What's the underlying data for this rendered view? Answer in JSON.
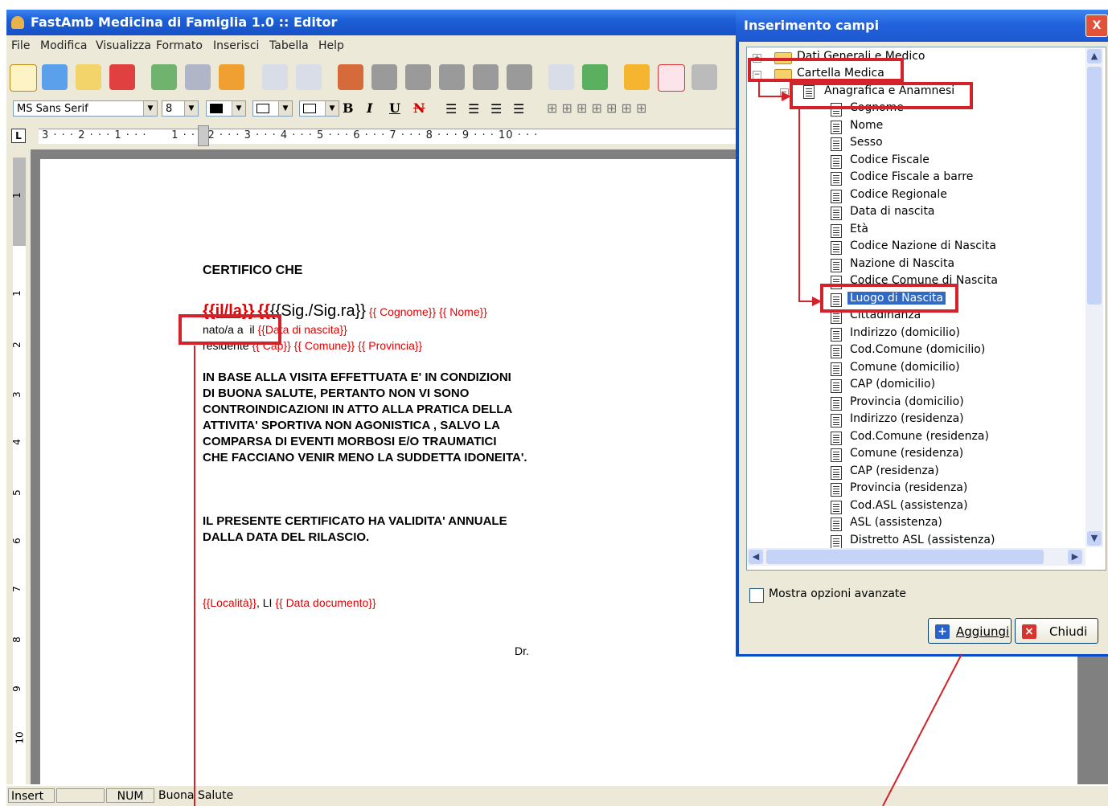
{
  "window": {
    "title": "FastAmb Medicina di Famiglia 1.0 :: Editor"
  },
  "menu": [
    {
      "label": "File"
    },
    {
      "label": "Modifica"
    },
    {
      "label": "Visualizza"
    },
    {
      "label": "Formato"
    },
    {
      "label": "Inserisci"
    },
    {
      "label": "Tabella"
    },
    {
      "label": "Help"
    }
  ],
  "format_bar": {
    "font": "MS Sans Serif",
    "size": "8",
    "bold": "B",
    "italic": "I",
    "underline": "U",
    "strike": "N"
  },
  "ruler": {
    "label": "L",
    "marks": "3 · · · 2 · · · 1 · · ·      1 · · · 2 · · · 3 · · · 4 · · · 5 · · · 6 · · · 7 · · · 8 · · · 9 · · · 10 · · ·"
  },
  "vruler": [
    "1",
    "1",
    "2",
    "3",
    "4",
    "5",
    "6",
    "7",
    "8",
    "9",
    "10"
  ],
  "document": {
    "heading": "CERTIFICO CHE",
    "line1": {
      "a": "{{il/la}}",
      "b": "{{Sig./Sig.ra}}",
      "c": "{{ Cognome}}",
      "d": "{{ Nome}}"
    },
    "line2": {
      "a": "nato/a a  il ",
      "b": "{{Data di nascita}}"
    },
    "line3": {
      "a": "residente ",
      "b": "{{ Cap}}",
      "c": "{{ Comune}}",
      "d": "{{ Provincia}}"
    },
    "body": [
      "IN BASE ALLA VISITA EFFETTUATA E'  IN CONDIZIONI",
      "DI BUONA SALUTE, PERTANTO NON VI SONO",
      "CONTROINDICAZIONI IN ATTO ALLA PRATICA DELLA",
      "ATTIVITA' SPORTIVA NON AGONISTICA , SALVO LA",
      "COMPARSA DI EVENTI MORBOSI E/O TRAUMATICI",
      "CHE FACCIANO VENIR MENO LA SUDDETTA IDONEITA'."
    ],
    "validity": [
      "IL PRESENTE CERTIFICATO HA VALIDITA' ANNUALE",
      "DALLA DATA DEL RILASCIO."
    ],
    "place": {
      "a": "{{Località}}",
      "b": ", LI ",
      "c": "{{ Data documento}}"
    },
    "doctor": "Dr."
  },
  "status": {
    "mode": "Insert",
    "blank": "",
    "num": "NUM",
    "doc": "Buona Salute"
  },
  "dialog": {
    "title": "Inserimento campi",
    "close": "X",
    "tree": {
      "root1": "Dati Generali e Medico",
      "root2": "Cartella Medica",
      "group": "Anagrafica e Anamnesi",
      "items": [
        "Cognome",
        "Nome",
        "Sesso",
        "Codice Fiscale",
        "Codice Fiscale a barre",
        "Codice Regionale",
        "Data di nascita",
        "Età",
        "Codice Nazione di Nascita",
        "Nazione di Nascita",
        "Codice Comune di Nascita",
        "Luogo di Nascita",
        "Cittadinanza",
        "Indirizzo (domicilio)",
        "Cod.Comune (domicilio)",
        "Comune (domicilio)",
        "CAP (domicilio)",
        "Provincia (domicilio)",
        "Indirizzo (residenza)",
        "Cod.Comune (residenza)",
        "Comune (residenza)",
        "CAP (residenza)",
        "Provincia (residenza)",
        "Cod.ASL (assistenza)",
        "ASL (assistenza)",
        "Distretto ASL (assistenza)"
      ],
      "selected": "Luogo di Nascita"
    },
    "advanced_label": "Mostra opzioni avanzate",
    "add_button": "Aggiungi",
    "close_button": "Chiudi"
  },
  "colors": {
    "annotation": "#d3222a",
    "placeholder": "#e60000",
    "selection": "#316ac5"
  }
}
